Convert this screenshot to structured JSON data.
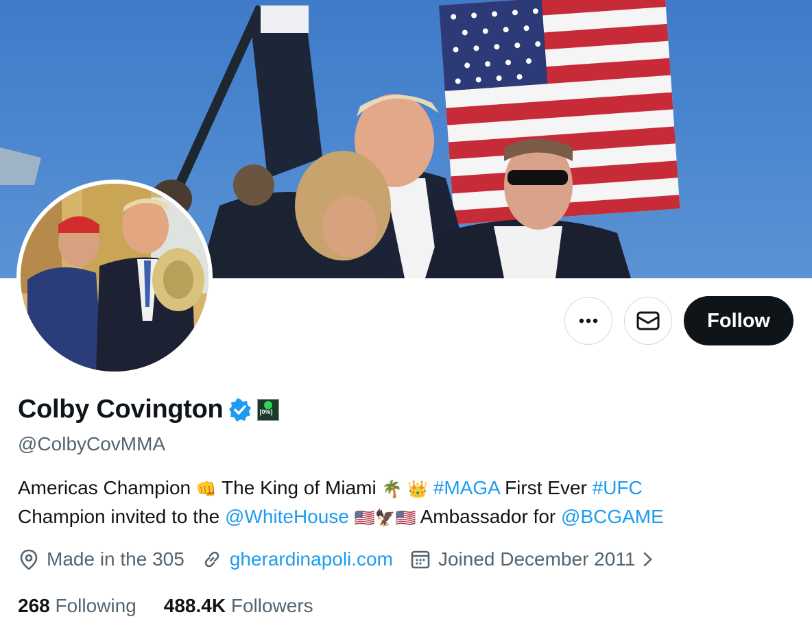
{
  "profile": {
    "name": "Colby Covington",
    "handle": "@ColbyCovMMA",
    "bio": {
      "part1": "Americas Champion ",
      "part2": " The King of Miami ",
      "tag_maga": "#MAGA",
      "part3": " First Ever ",
      "tag_ufc": "#UFC",
      "part4": "Champion invited to the ",
      "mention_whitehouse": "@WhiteHouse",
      "part5": " Ambassador for ",
      "mention_bcgame": "@BCGAME"
    },
    "location": "Made in the 305",
    "website": "gherardinapoli.com",
    "joined": "Joined December 2011",
    "following_count": "268",
    "following_label": "Following",
    "followers_count": "488.4K",
    "followers_label": "Followers"
  },
  "actions": {
    "follow_label": "Follow",
    "more_icon": "more-icon",
    "message_icon": "envelope-icon"
  },
  "badge": {
    "label": "[0%]"
  },
  "colors": {
    "link": "#1d9bf0",
    "text": "#0f1419",
    "muted": "#536471",
    "verified": "#1d9bf0",
    "follow_bg": "#0f1419"
  }
}
